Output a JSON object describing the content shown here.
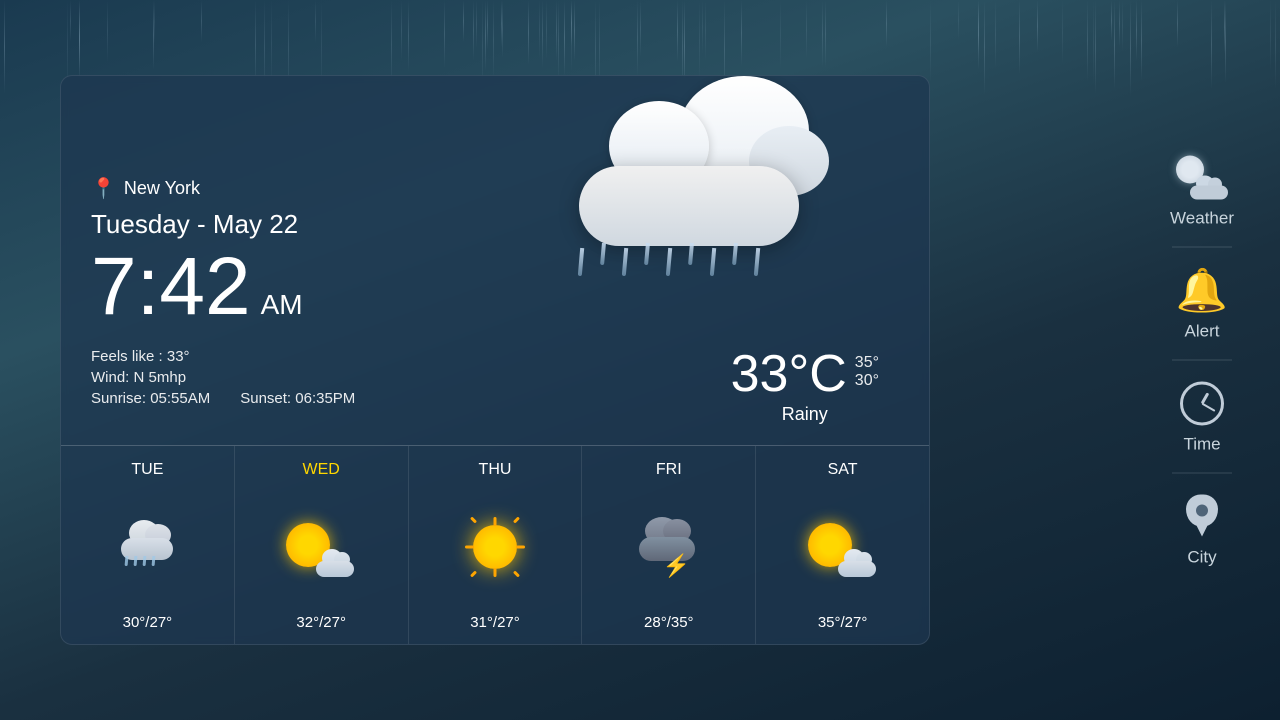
{
  "background": {
    "color": "#1a3a4a"
  },
  "location": {
    "city": "New York",
    "pin": "📍"
  },
  "datetime": {
    "date": "Tuesday - May 22",
    "time": "7:42",
    "ampm": "AM"
  },
  "current_weather": {
    "feels_like": "Feels like : 33°",
    "wind": "Wind: N 5mhp",
    "sunrise": "Sunrise: 05:55AM",
    "sunset": "Sunset: 06:35PM",
    "temperature": "33°C",
    "temp_high": "35°",
    "temp_low": "30°",
    "condition": "Rainy"
  },
  "forecast": [
    {
      "day": "TUE",
      "temp": "30°/27°",
      "icon": "rain-cloud",
      "highlight": false
    },
    {
      "day": "WED",
      "temp": "32°/27°",
      "icon": "sun-cloud",
      "highlight": true
    },
    {
      "day": "THU",
      "temp": "31°/27°",
      "icon": "sun",
      "highlight": false
    },
    {
      "day": "FRI",
      "temp": "28°/35°",
      "icon": "thunder",
      "highlight": false
    },
    {
      "day": "SAT",
      "temp": "35°/27°",
      "icon": "sun-cloud",
      "highlight": false
    }
  ],
  "sidebar": {
    "items": [
      {
        "id": "weather",
        "label": "Weather",
        "icon": "sun-cloud-icon"
      },
      {
        "id": "alert",
        "label": "Alert",
        "icon": "bell-icon"
      },
      {
        "id": "time",
        "label": "Time",
        "icon": "clock-icon"
      },
      {
        "id": "city",
        "label": "City",
        "icon": "location-pin-icon"
      }
    ]
  }
}
